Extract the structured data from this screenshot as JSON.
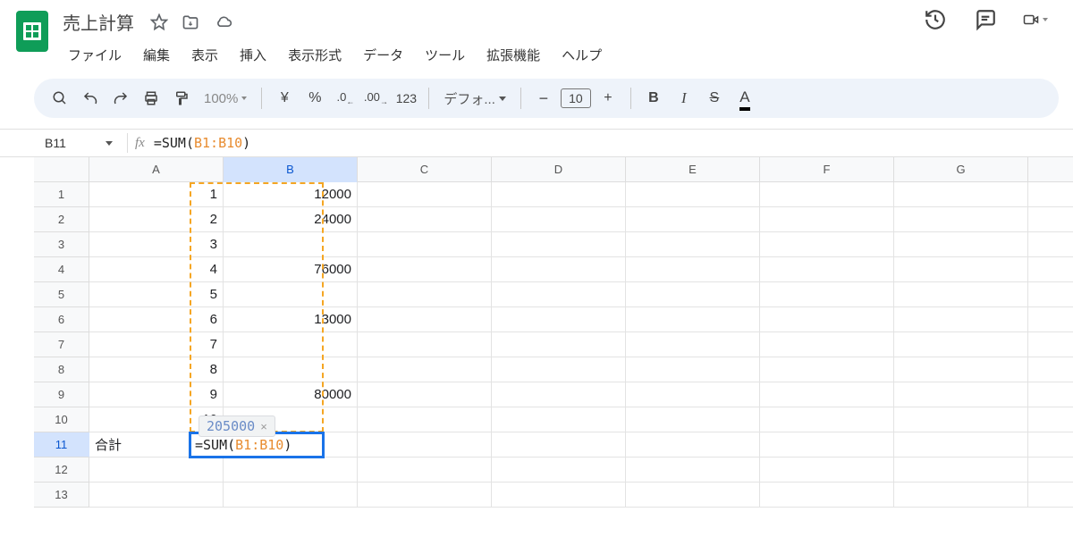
{
  "doc": {
    "title": "売上計算"
  },
  "menus": [
    "ファイル",
    "編集",
    "表示",
    "挿入",
    "表示形式",
    "データ",
    "ツール",
    "拡張機能",
    "ヘルプ"
  ],
  "toolbar": {
    "zoom": "100%",
    "currency": "¥",
    "percent": "%",
    "dec_dec": ".0",
    "dec_inc": ".00",
    "numfmt": "123",
    "font": "デフォ...",
    "minus": "−",
    "font_size": "10",
    "plus": "+",
    "bold": "B",
    "italic": "I",
    "strike": "S",
    "textcolor": "A"
  },
  "name_box": "B11",
  "formula_bar": {
    "func": "=SUM(",
    "range": "B1:B10",
    "close": ")"
  },
  "columns": [
    "A",
    "B",
    "C",
    "D",
    "E",
    "F",
    "G"
  ],
  "row_numbers": [
    1,
    2,
    3,
    4,
    5,
    6,
    7,
    8,
    9,
    10,
    11,
    12,
    13
  ],
  "data": {
    "A": [
      "1",
      "2",
      "3",
      "4",
      "5",
      "6",
      "7",
      "8",
      "9",
      "10",
      "合計",
      "",
      ""
    ],
    "B": [
      "12000",
      "24000",
      "",
      "76000",
      "",
      "13000",
      "",
      "",
      "80000",
      "",
      "",
      "",
      ""
    ]
  },
  "active_formula": {
    "func": "=SUM(",
    "range": "B1:B10",
    "close": ")"
  },
  "hint": {
    "value": "205000",
    "close": "×"
  },
  "selected": {
    "col": "B",
    "row": 11
  }
}
